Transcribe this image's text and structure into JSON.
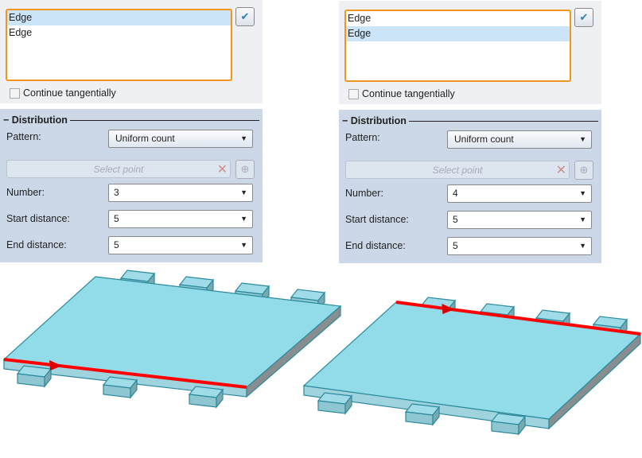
{
  "panels": [
    {
      "list_items": [
        "Edge",
        "Edge"
      ],
      "selected_index": 0,
      "continue_label": "Continue tangentially",
      "section": "Distribution",
      "pattern_label": "Pattern:",
      "pattern_value": "Uniform count",
      "select_point_placeholder": "Select point",
      "number_label": "Number:",
      "number_value": "3",
      "start_label": "Start distance:",
      "start_value": "5",
      "end_label": "End distance:",
      "end_value": "5"
    },
    {
      "list_items": [
        "Edge",
        "Edge"
      ],
      "selected_index": 1,
      "continue_label": "Continue tangentially",
      "section": "Distribution",
      "pattern_label": "Pattern:",
      "pattern_value": "Uniform count",
      "select_point_placeholder": "Select point",
      "number_label": "Number:",
      "number_value": "4",
      "start_label": "Start distance:",
      "start_value": "5",
      "end_label": "End distance:",
      "end_value": "5"
    }
  ],
  "colors": {
    "accent": "#f0961e",
    "edge": "#ff0000",
    "plate": "#92dcea"
  }
}
